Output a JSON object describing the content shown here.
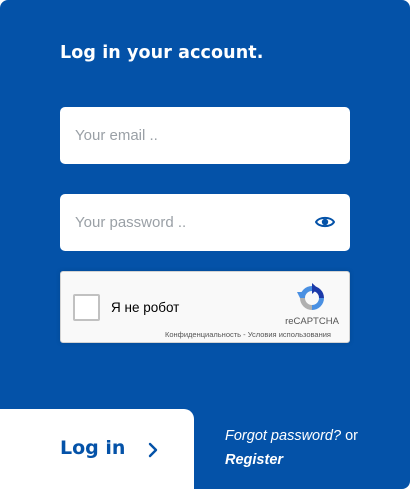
{
  "heading": "Log in your account.",
  "email": {
    "placeholder": "Your email ..",
    "value": ""
  },
  "password": {
    "placeholder": "Your password ..",
    "value": "",
    "toggle_icon": "eye-icon"
  },
  "captcha": {
    "label": "Я не робот",
    "brand": "reCAPTCHA",
    "links": "Конфиденциальность - Условия использования",
    "checked": false,
    "logo_icon": "recaptcha-logo-icon"
  },
  "login": {
    "label": "Log in",
    "icon": "chevron-right-icon"
  },
  "footer": {
    "forgot": "Forgot password?",
    "or": "or",
    "register": "Register"
  },
  "colors": {
    "panel": "#0452a8",
    "accent": "#0452a8",
    "field": "#ffffff"
  }
}
